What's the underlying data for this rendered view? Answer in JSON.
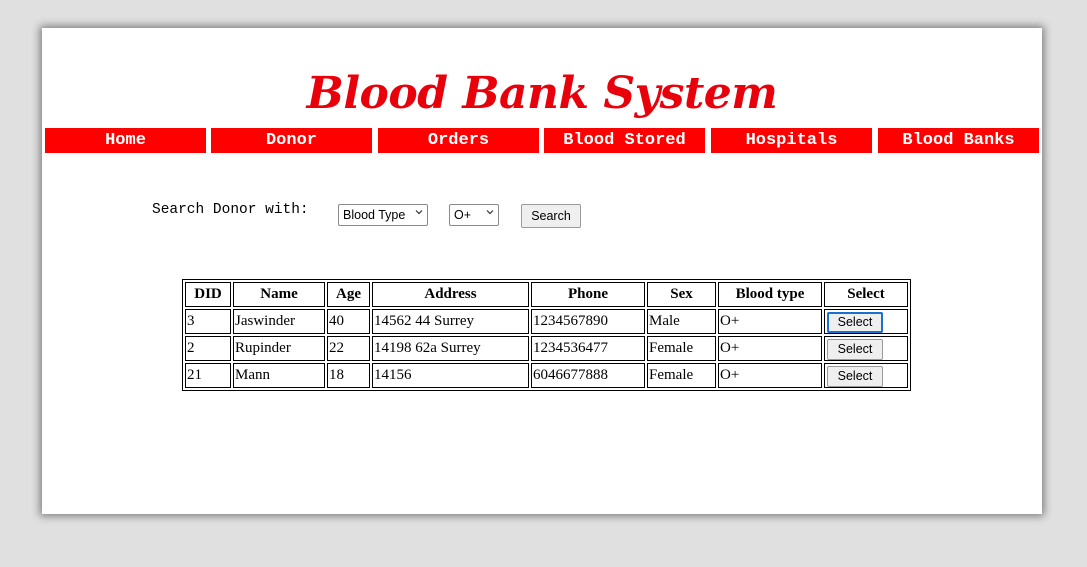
{
  "header": {
    "title": "Blood Bank System"
  },
  "nav": {
    "items": [
      {
        "label": "Home"
      },
      {
        "label": "Donor"
      },
      {
        "label": "Orders"
      },
      {
        "label": "Blood Stored"
      },
      {
        "label": "Hospitals"
      },
      {
        "label": "Blood Banks"
      }
    ]
  },
  "search": {
    "label": "Search Donor with:",
    "field_select": "Blood Type",
    "value_select": "O+",
    "button_label": "Search"
  },
  "table": {
    "headers": [
      "DID",
      "Name",
      "Age",
      "Address",
      "Phone",
      "Sex",
      "Blood type",
      "Select"
    ],
    "rows": [
      {
        "did": "3",
        "name": "Jaswinder",
        "age": "40",
        "address": "14562 44 Surrey",
        "phone": "1234567890",
        "sex": "Male",
        "blood_type": "O+",
        "select": "Select"
      },
      {
        "did": "2",
        "name": "Rupinder",
        "age": "22",
        "address": "14198 62a Surrey",
        "phone": "1234536477",
        "sex": "Female",
        "blood_type": "O+",
        "select": "Select"
      },
      {
        "did": "21",
        "name": "Mann",
        "age": "18",
        "address": "14156",
        "phone": "6046677888",
        "sex": "Female",
        "blood_type": "O+",
        "select": "Select"
      }
    ]
  },
  "colors": {
    "brand_red": "#ff0000",
    "title_red": "#e8000b",
    "focus_blue": "#1a6fd0"
  }
}
